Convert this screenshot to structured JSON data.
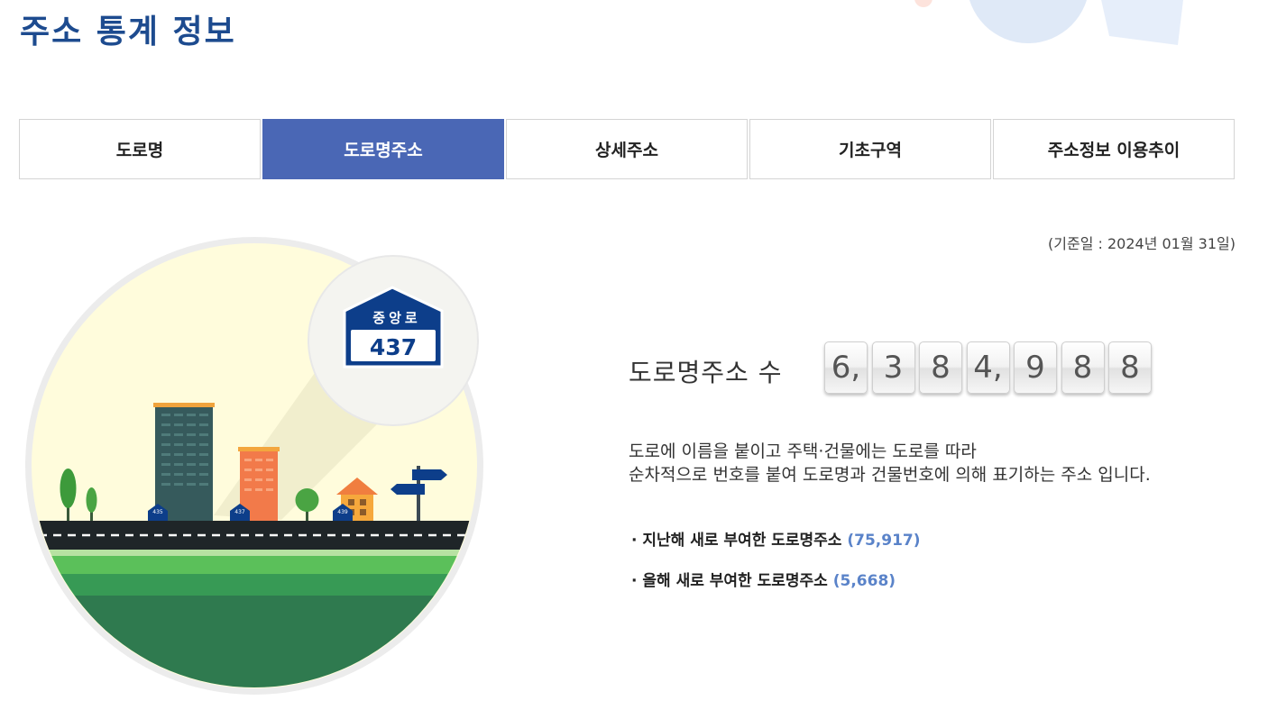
{
  "page": {
    "title": "주소 통계 정보"
  },
  "tabs": [
    {
      "label": "도로명",
      "active": false
    },
    {
      "label": "도로명주소",
      "active": true
    },
    {
      "label": "상세주소",
      "active": false
    },
    {
      "label": "기초구역",
      "active": false
    },
    {
      "label": "주소정보 이용추이",
      "active": false
    }
  ],
  "base_date": "(기준일 : 2024년 01월 31일)",
  "illustration": {
    "sign_road_name": "중앙로",
    "sign_number": "437",
    "plate_numbers": [
      "435",
      "437",
      "439"
    ]
  },
  "counter": {
    "label": "도로명주소 수",
    "digits": [
      "6,",
      "3",
      "8",
      "4,",
      "9",
      "8",
      "8"
    ]
  },
  "description": {
    "line1": "도로에 이름을 붙이고 주택·건물에는 도로를 따라",
    "line2": "순차적으로 번호를 붙여 도로명과 건물번호에 의해 표기하는 주소 입니다."
  },
  "stats": [
    {
      "label": "· 지난해 새로 부여한 도로명주소",
      "value": "(75,917)"
    },
    {
      "label": "· 올해 새로 부여한 도로명주소",
      "value": "(5,668)"
    }
  ],
  "colors": {
    "accent": "#4a67b5",
    "title": "#1d4b8f",
    "stat_value": "#5a83c9",
    "sign_blue": "#0d3e8a"
  }
}
